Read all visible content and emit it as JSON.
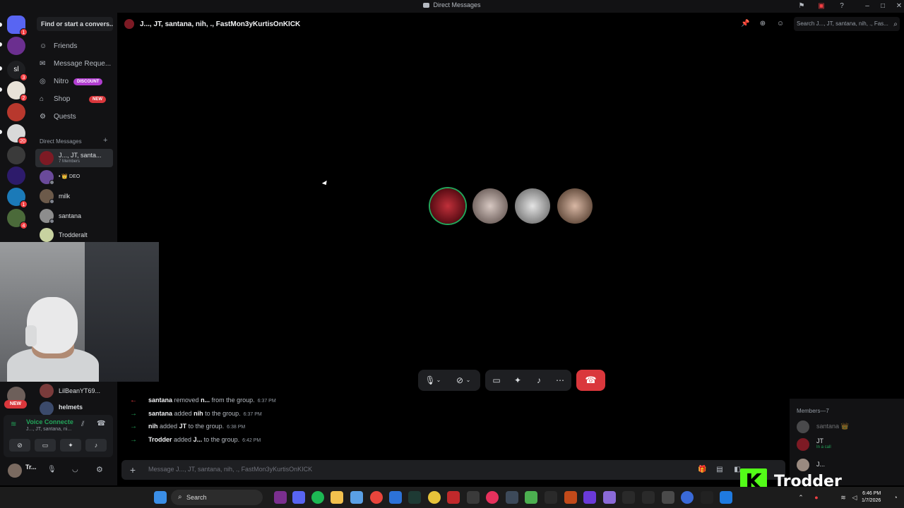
{
  "window": {
    "title": "Direct Messages"
  },
  "sidebar": {
    "find_placeholder": "Find or start a convers...",
    "nav": [
      {
        "label": "Friends",
        "icon": "friends-icon"
      },
      {
        "label": "Message Reque...",
        "icon": "envelope-icon"
      },
      {
        "label": "Nitro",
        "icon": "nitro-icon",
        "pill": "DISCOUNT"
      },
      {
        "label": "Shop",
        "icon": "shop-icon",
        "pill": "NEW"
      },
      {
        "label": "Quests",
        "icon": "quests-icon"
      }
    ],
    "dm_header": "Direct Messages",
    "dms": [
      {
        "name": "J..., JT, santa...",
        "sub": "7 Members"
      },
      {
        "name": "• 👑 DEO"
      },
      {
        "name": "milk"
      },
      {
        "name": "santana"
      },
      {
        "name": "Trodderalt"
      },
      {
        "name": "LilBeanYT69..."
      },
      {
        "name": "helmets"
      }
    ]
  },
  "rail": {
    "badges": [
      "1",
      "3",
      "2",
      "20",
      "1",
      "4"
    ],
    "new_label": "NEW",
    "sl_label": "sl"
  },
  "voice": {
    "title": "Voice Connecte",
    "sub": "J..., JT, santana, ni..."
  },
  "user": {
    "name": "Tr..."
  },
  "call": {
    "header_name": "J..., JT, santana, nih, ., FastMon3yKurtisOnKICK",
    "search_placeholder": "Search J..., JT, santana, nih, ., Fas..."
  },
  "messages": [
    {
      "arrow": "←",
      "type": "red",
      "actor": "santana",
      "verb": "removed",
      "target": "n...",
      "rest": "from the group.",
      "time": "6:37 PM"
    },
    {
      "arrow": "→",
      "type": "green",
      "actor": "santana",
      "verb": "added",
      "target": "nih",
      "rest": "to the group.",
      "time": "6:37 PM"
    },
    {
      "arrow": "→",
      "type": "green",
      "actor": "nih",
      "verb": "added",
      "target": "JT",
      "rest": "to the group.",
      "time": "6:38 PM"
    },
    {
      "arrow": "→",
      "type": "green",
      "actor": "Trodder",
      "verb": "added",
      "target": "J...",
      "rest": "to the group.",
      "time": "6:42 PM"
    }
  ],
  "composer": {
    "placeholder": "Message J..., JT, santana, nih, ., FastMon3yKurtisOnKICK"
  },
  "members": {
    "header": "Members—7",
    "list": [
      {
        "name": "santana 👑",
        "sub": ""
      },
      {
        "name": "JT",
        "sub": "In a call"
      },
      {
        "name": "J...",
        "sub": ""
      }
    ]
  },
  "overlay": {
    "kick_name": "Trodder"
  },
  "taskbar": {
    "search": "Search",
    "time": "6:46 PM",
    "date": "1/7/2026"
  },
  "colors": {
    "accent_green": "#23a55a",
    "danger_red": "#da373c",
    "kick_green": "#53fc18",
    "nitro_pill": "#b13ed0",
    "new_pill": "#da373c"
  }
}
